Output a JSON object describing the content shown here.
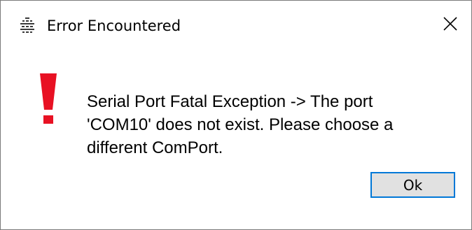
{
  "window": {
    "title": "Error Encountered",
    "app_icon": "app-logo-icon",
    "close_icon": "close-icon"
  },
  "dialog": {
    "icon": "error-exclamation-icon",
    "icon_color": "#e81123",
    "message": "Serial Port Fatal Exception -> The port 'COM10' does not exist.  Please choose a different ComPort.",
    "ok_label": "Ok",
    "ok_border_color": "#0078d7"
  }
}
